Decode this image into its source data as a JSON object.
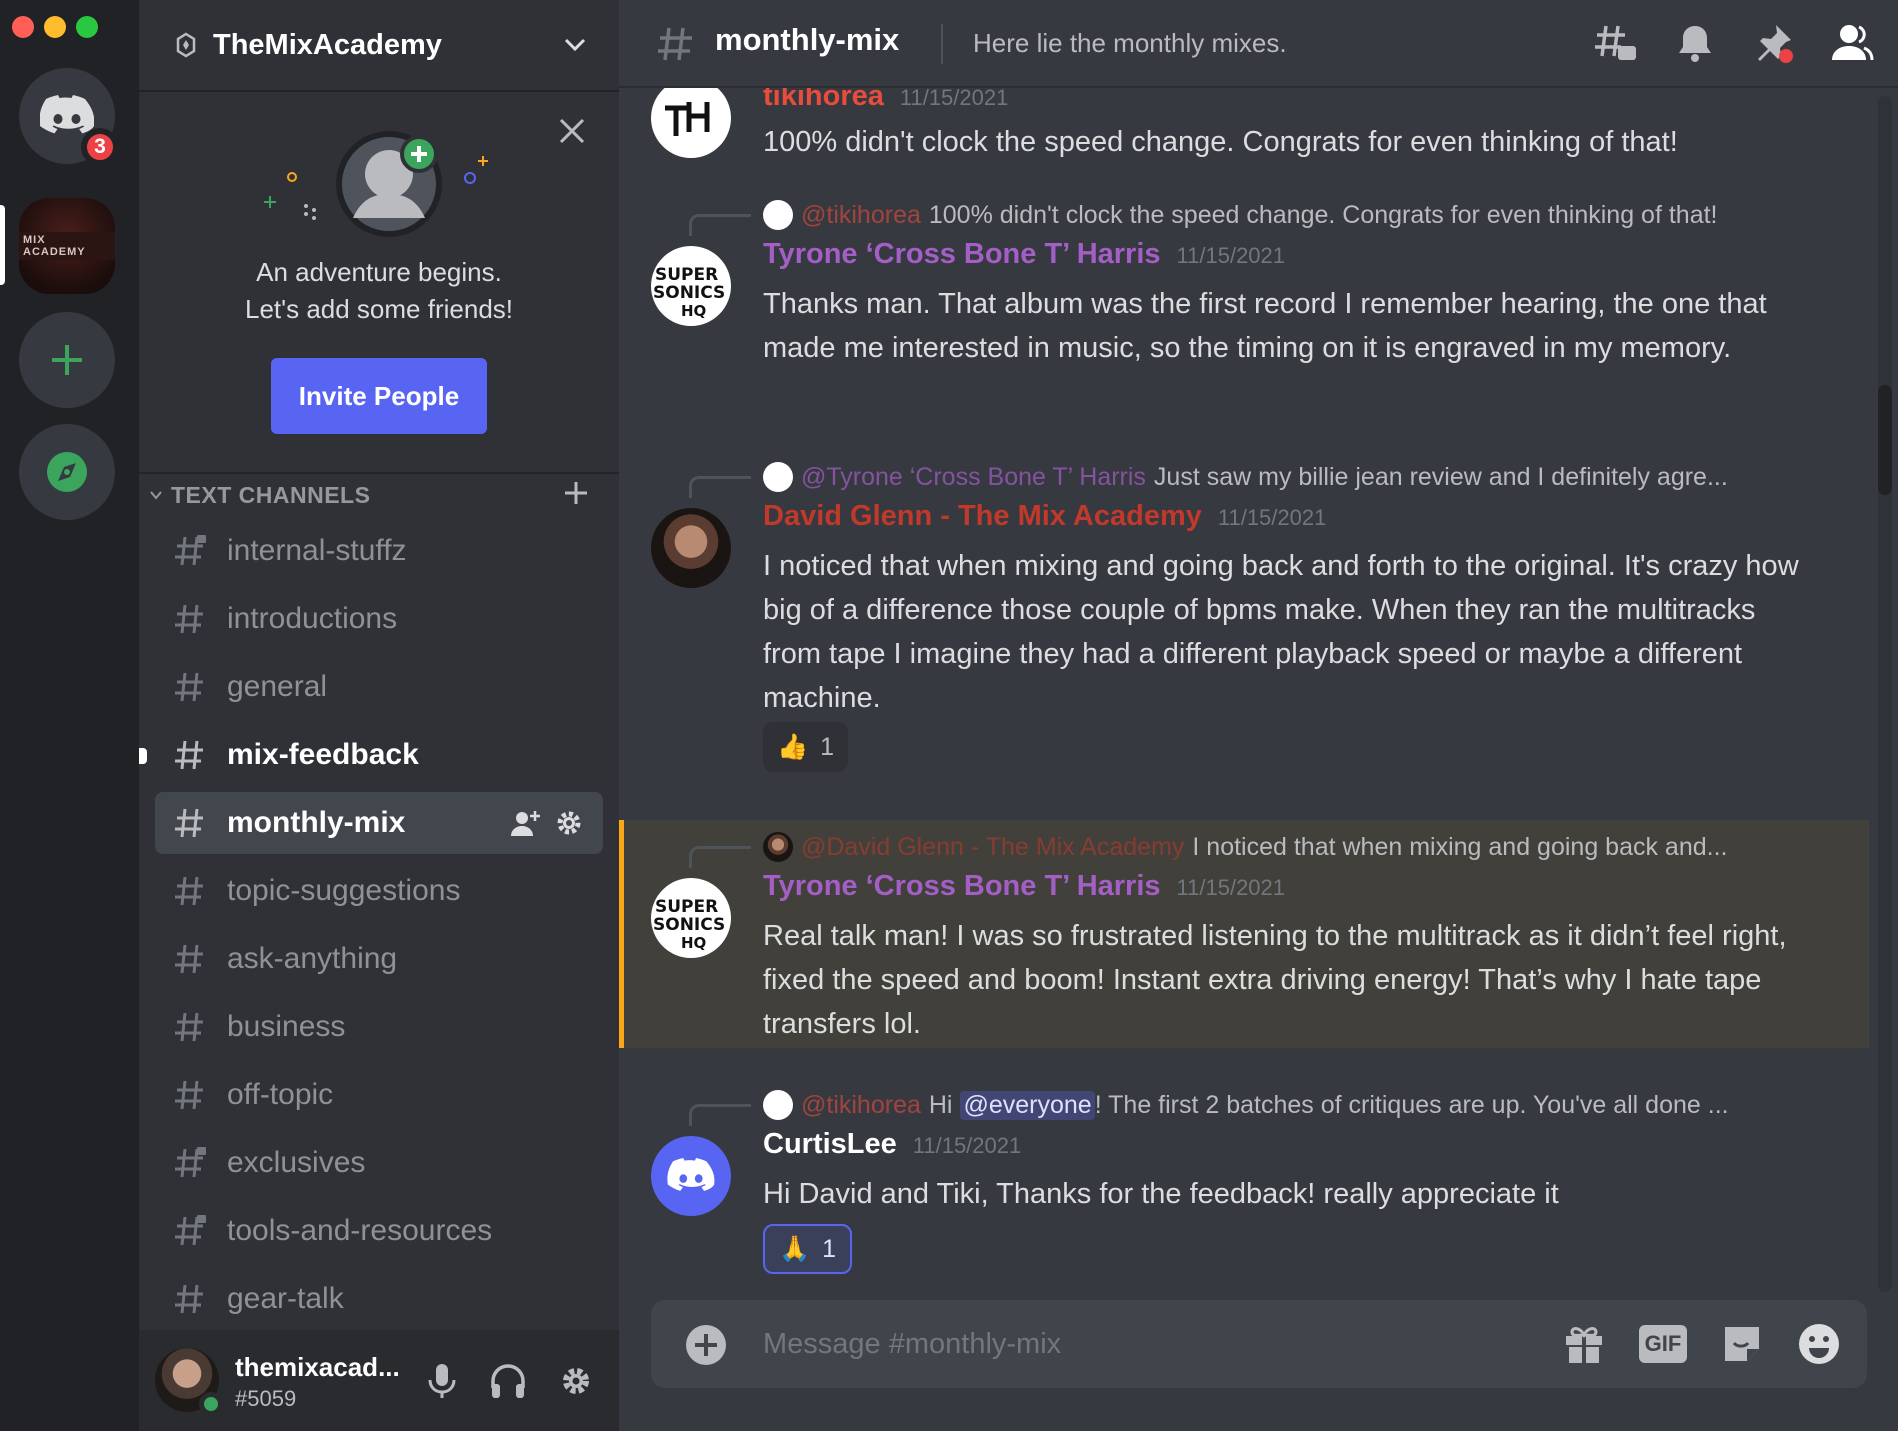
{
  "window": {
    "traffic_colors": [
      "#ff5f57",
      "#febc2e",
      "#28c840"
    ]
  },
  "rail": {
    "home_badge": "3",
    "server_icon_text": "MIX ACADEMY",
    "add_server_icon": "plus-icon",
    "explore_icon": "compass-icon"
  },
  "server": {
    "name": "TheMixAcademy"
  },
  "friends_card": {
    "line1": "An adventure begins.",
    "line2": "Let's add some friends!",
    "invite_label": "Invite People"
  },
  "category": {
    "label": "TEXT CHANNELS"
  },
  "channels": [
    {
      "label": "internal-stuffz",
      "locked": true
    },
    {
      "label": "introductions"
    },
    {
      "label": "general"
    },
    {
      "label": "mix-feedback",
      "unread": true
    },
    {
      "label": "monthly-mix",
      "active": true
    },
    {
      "label": "topic-suggestions"
    },
    {
      "label": "ask-anything"
    },
    {
      "label": "business"
    },
    {
      "label": "off-topic"
    },
    {
      "label": "exclusives",
      "locked": true
    },
    {
      "label": "tools-and-resources",
      "locked": true
    },
    {
      "label": "gear-talk"
    }
  ],
  "user": {
    "name": "themixacad...",
    "tag": "#5059"
  },
  "chat": {
    "channel": "monthly-mix",
    "topic": "Here lie the monthly mixes.",
    "placeholder": "Message #monthly-mix"
  },
  "messages": [
    {
      "author": "tikihorea",
      "author_color": "#e74c3c",
      "timestamp": "11/15/2021",
      "body": "100% didn't clock the speed change. Congrats for even thinking of that!"
    },
    {
      "reply_to": "@tikihorea",
      "reply_color": "#e74c3c",
      "reply_text": "100% didn't clock the speed change. Congrats for even thinking of that!",
      "author": "Tyrone ‘Cross Bone T’ Harris",
      "author_color": "#a45fc7",
      "timestamp": "11/15/2021",
      "body": "Thanks man. That album was the first record I remember hearing, the one that made me interested in music, so the timing on it is engraved in my memory."
    },
    {
      "reply_to": "@Tyrone ‘Cross Bone T’ Harris",
      "reply_color": "#a45fc7",
      "reply_text": "Just saw my billie jean review and I definitely agre...",
      "author": "David Glenn - The Mix Academy",
      "author_color": "#c0392b",
      "timestamp": "11/15/2021",
      "body": "I noticed that when mixing and going back and forth to the original. It's crazy how big of a difference those couple of bpms make. When they ran the multitracks from tape I imagine they had a different playback speed or maybe a different machine.",
      "reaction": {
        "emoji": "👍",
        "count": "1"
      }
    },
    {
      "reply_to": "@David Glenn - The Mix Academy",
      "reply_color": "#c0392b",
      "reply_text": "I noticed that when mixing and going back and...",
      "author": "Tyrone ‘Cross Bone T’ Harris",
      "author_color": "#a45fc7",
      "timestamp": "11/15/2021",
      "body": "Real talk man! I was so frustrated listening to the multitrack as it didn’t feel right, fixed the speed and boom! Instant extra driving energy! That’s why I hate tape transfers lol."
    },
    {
      "reply_to": "@tikihorea",
      "reply_color": "#e74c3c",
      "reply_pre": "Hi",
      "reply_mention": "@everyone",
      "reply_text": "! The first 2 batches of critiques are up. You've all done ...",
      "author": "CurtisLee",
      "author_color": "#ffffff",
      "timestamp": "11/15/2021",
      "body": "Hi David and Tiki,  Thanks for the feedback!  really appreciate it",
      "reaction": {
        "emoji": "🙏",
        "count": "1"
      }
    }
  ],
  "colors": {
    "accent": "#5865f2",
    "mention_highlight": "#faa81a",
    "online": "#3ba55d"
  }
}
